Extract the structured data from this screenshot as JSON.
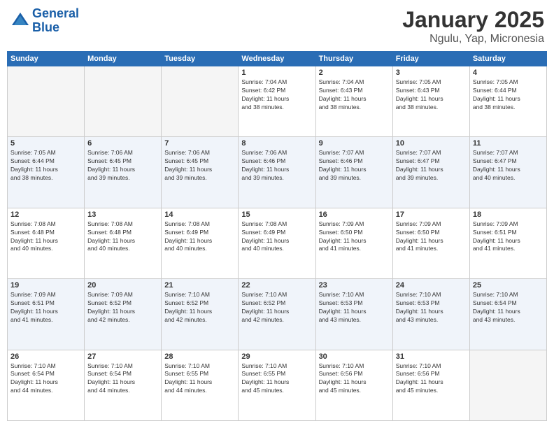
{
  "header": {
    "logo_line1": "General",
    "logo_line2": "Blue",
    "title": "January 2025",
    "subtitle": "Ngulu, Yap, Micronesia"
  },
  "weekdays": [
    "Sunday",
    "Monday",
    "Tuesday",
    "Wednesday",
    "Thursday",
    "Friday",
    "Saturday"
  ],
  "weeks": [
    [
      {
        "day": "",
        "info": ""
      },
      {
        "day": "",
        "info": ""
      },
      {
        "day": "",
        "info": ""
      },
      {
        "day": "1",
        "info": "Sunrise: 7:04 AM\nSunset: 6:42 PM\nDaylight: 11 hours\nand 38 minutes."
      },
      {
        "day": "2",
        "info": "Sunrise: 7:04 AM\nSunset: 6:43 PM\nDaylight: 11 hours\nand 38 minutes."
      },
      {
        "day": "3",
        "info": "Sunrise: 7:05 AM\nSunset: 6:43 PM\nDaylight: 11 hours\nand 38 minutes."
      },
      {
        "day": "4",
        "info": "Sunrise: 7:05 AM\nSunset: 6:44 PM\nDaylight: 11 hours\nand 38 minutes."
      }
    ],
    [
      {
        "day": "5",
        "info": "Sunrise: 7:05 AM\nSunset: 6:44 PM\nDaylight: 11 hours\nand 38 minutes."
      },
      {
        "day": "6",
        "info": "Sunrise: 7:06 AM\nSunset: 6:45 PM\nDaylight: 11 hours\nand 39 minutes."
      },
      {
        "day": "7",
        "info": "Sunrise: 7:06 AM\nSunset: 6:45 PM\nDaylight: 11 hours\nand 39 minutes."
      },
      {
        "day": "8",
        "info": "Sunrise: 7:06 AM\nSunset: 6:46 PM\nDaylight: 11 hours\nand 39 minutes."
      },
      {
        "day": "9",
        "info": "Sunrise: 7:07 AM\nSunset: 6:46 PM\nDaylight: 11 hours\nand 39 minutes."
      },
      {
        "day": "10",
        "info": "Sunrise: 7:07 AM\nSunset: 6:47 PM\nDaylight: 11 hours\nand 39 minutes."
      },
      {
        "day": "11",
        "info": "Sunrise: 7:07 AM\nSunset: 6:47 PM\nDaylight: 11 hours\nand 40 minutes."
      }
    ],
    [
      {
        "day": "12",
        "info": "Sunrise: 7:08 AM\nSunset: 6:48 PM\nDaylight: 11 hours\nand 40 minutes."
      },
      {
        "day": "13",
        "info": "Sunrise: 7:08 AM\nSunset: 6:48 PM\nDaylight: 11 hours\nand 40 minutes."
      },
      {
        "day": "14",
        "info": "Sunrise: 7:08 AM\nSunset: 6:49 PM\nDaylight: 11 hours\nand 40 minutes."
      },
      {
        "day": "15",
        "info": "Sunrise: 7:08 AM\nSunset: 6:49 PM\nDaylight: 11 hours\nand 40 minutes."
      },
      {
        "day": "16",
        "info": "Sunrise: 7:09 AM\nSunset: 6:50 PM\nDaylight: 11 hours\nand 41 minutes."
      },
      {
        "day": "17",
        "info": "Sunrise: 7:09 AM\nSunset: 6:50 PM\nDaylight: 11 hours\nand 41 minutes."
      },
      {
        "day": "18",
        "info": "Sunrise: 7:09 AM\nSunset: 6:51 PM\nDaylight: 11 hours\nand 41 minutes."
      }
    ],
    [
      {
        "day": "19",
        "info": "Sunrise: 7:09 AM\nSunset: 6:51 PM\nDaylight: 11 hours\nand 41 minutes."
      },
      {
        "day": "20",
        "info": "Sunrise: 7:09 AM\nSunset: 6:52 PM\nDaylight: 11 hours\nand 42 minutes."
      },
      {
        "day": "21",
        "info": "Sunrise: 7:10 AM\nSunset: 6:52 PM\nDaylight: 11 hours\nand 42 minutes."
      },
      {
        "day": "22",
        "info": "Sunrise: 7:10 AM\nSunset: 6:52 PM\nDaylight: 11 hours\nand 42 minutes."
      },
      {
        "day": "23",
        "info": "Sunrise: 7:10 AM\nSunset: 6:53 PM\nDaylight: 11 hours\nand 43 minutes."
      },
      {
        "day": "24",
        "info": "Sunrise: 7:10 AM\nSunset: 6:53 PM\nDaylight: 11 hours\nand 43 minutes."
      },
      {
        "day": "25",
        "info": "Sunrise: 7:10 AM\nSunset: 6:54 PM\nDaylight: 11 hours\nand 43 minutes."
      }
    ],
    [
      {
        "day": "26",
        "info": "Sunrise: 7:10 AM\nSunset: 6:54 PM\nDaylight: 11 hours\nand 44 minutes."
      },
      {
        "day": "27",
        "info": "Sunrise: 7:10 AM\nSunset: 6:54 PM\nDaylight: 11 hours\nand 44 minutes."
      },
      {
        "day": "28",
        "info": "Sunrise: 7:10 AM\nSunset: 6:55 PM\nDaylight: 11 hours\nand 44 minutes."
      },
      {
        "day": "29",
        "info": "Sunrise: 7:10 AM\nSunset: 6:55 PM\nDaylight: 11 hours\nand 45 minutes."
      },
      {
        "day": "30",
        "info": "Sunrise: 7:10 AM\nSunset: 6:56 PM\nDaylight: 11 hours\nand 45 minutes."
      },
      {
        "day": "31",
        "info": "Sunrise: 7:10 AM\nSunset: 6:56 PM\nDaylight: 11 hours\nand 45 minutes."
      },
      {
        "day": "",
        "info": ""
      }
    ]
  ]
}
